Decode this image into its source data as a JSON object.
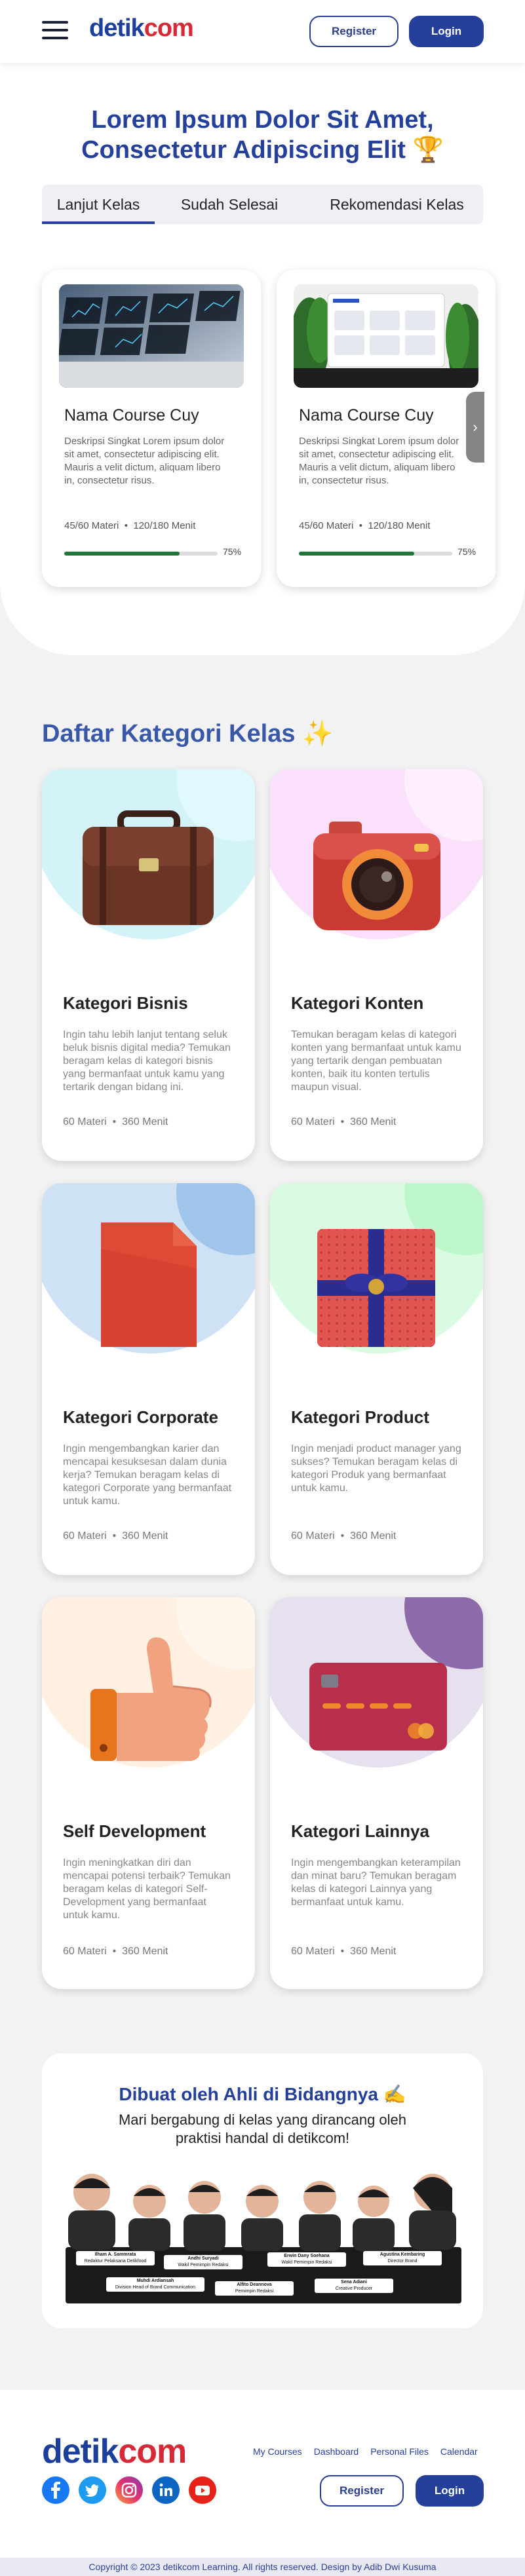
{
  "header": {
    "logo": {
      "part1": "detik",
      "part2": "com"
    },
    "register_label": "Register",
    "login_label": "Login"
  },
  "hero": {
    "line1": "Lorem Ipsum Dolor Sit Amet,",
    "line2": "Consectetur Adipiscing Elit",
    "emoji": "🏆"
  },
  "tabs": [
    {
      "label": "Lanjut Kelas",
      "active": true
    },
    {
      "label": "Sudah Selesai",
      "active": false
    },
    {
      "label": "Rekomendasi Kelas",
      "active": false
    }
  ],
  "courses": [
    {
      "title": "Nama Course Cuy",
      "desc": "Deskripsi Singkat Lorem ipsum dolor sit amet, consectetur adipiscing elit. Mauris a velit dictum, aliquam libero in, consectetur risus.",
      "materi": "45/60 Materi",
      "menit": "120/180 Menit",
      "progress": "75%",
      "progress_value": 0.75
    },
    {
      "title": "Nama Course Cuy",
      "desc": "Deskripsi Singkat Lorem ipsum dolor sit amet, consectetur adipiscing elit. Mauris a velit dictum, aliquam libero in, consectetur risus.",
      "materi": "45/60 Materi",
      "menit": "120/180 Menit",
      "progress": "75%",
      "progress_value": 0.75
    }
  ],
  "next_icon": "chevron-right-icon",
  "categories_title": "Daftar Kategori Kelas",
  "categories_emoji": "✨",
  "categories": [
    {
      "title": "Kategori Bisnis",
      "desc": "Ingin tahu lebih lanjut tentang seluk beluk bisnis digital media? Temukan beragam kelas di kategori bisnis yang bermanfaat untuk kamu yang tertarik dengan bidang ini.",
      "materi": "60 Materi",
      "menit": "360 Menit",
      "bg": "#d3f3f9",
      "accent": "#e4faff",
      "icon": "briefcase-icon"
    },
    {
      "title": "Kategori Konten",
      "desc": "Temukan beragam kelas di kategori konten yang bermanfaat untuk kamu yang tertarik dengan pembuatan konten, baik itu konten tertulis maupun visual.",
      "materi": "60 Materi",
      "menit": "360 Menit",
      "bg": "#fbe0fb",
      "accent": "#fff0ff",
      "icon": "camera-icon"
    },
    {
      "title": "Kategori Corporate",
      "desc": "Ingin mengembangkan karier dan mencapai kesuksesan dalam dunia kerja? Temukan beragam kelas di kategori Corporate yang bermanfaat untuk kamu.",
      "materi": "60 Materi",
      "menit": "360 Menit",
      "bg": "#cfe1f5",
      "accent": "#9fc6ea",
      "icon": "document-icon"
    },
    {
      "title": "Kategori Product",
      "desc": "Ingin menjadi product manager yang sukses? Temukan beragam kelas di kategori Produk yang bermanfaat untuk kamu.",
      "materi": "60 Materi",
      "menit": "360 Menit",
      "bg": "#d9fbe2",
      "accent": "#bff7cd",
      "icon": "gift-icon"
    },
    {
      "title": "Self Development",
      "desc": "Ingin meningkatkan diri dan mencapai potensi terbaik? Temukan beragam kelas di kategori Self-Development yang bermanfaat untuk kamu.",
      "materi": "60 Materi",
      "menit": "360 Menit",
      "bg": "#fff0e1",
      "accent": "#fff5ea",
      "icon": "thumbs-up-icon"
    },
    {
      "title": "Kategori Lainnya",
      "desc": "Ingin mengembangkan keterampilan dan minat baru? Temukan beragam kelas di kategori Lainnya yang bermanfaat untuk kamu.",
      "materi": "60 Materi",
      "menit": "360 Menit",
      "bg": "#e6e0ef",
      "accent": "#8d6aaa",
      "icon": "credit-card-icon"
    }
  ],
  "experts": {
    "title": "Dibuat oleh Ahli di Bidangnya",
    "emoji": "✍️",
    "subtitle_line1": "Mari bergabung di kelas yang dirancang oleh",
    "subtitle_line2": "praktisi handal di detikcom!",
    "names": [
      {
        "name": "Ilham A. Sammrata",
        "role": "Redaktur Pelaksana Detikfood"
      },
      {
        "name": "Andhi Suryadi",
        "role": "Wakil Pemimpin Redaksi"
      },
      {
        "name": "Erwin Dany Soehana",
        "role": "Wakil Pemimpin Redaksi"
      },
      {
        "name": "Agustina Kembaring",
        "role": "Director Brand"
      },
      {
        "name": "Muhdi Ardiansah",
        "role": "Division Head of Brand Communication"
      },
      {
        "name": "Alfito Deannova",
        "role": "Pemimpin Redaksi"
      },
      {
        "name": "Sena Adiani",
        "role": "Creative Producer"
      }
    ]
  },
  "footer": {
    "logo": {
      "part1": "detik",
      "part2": "com"
    },
    "links": [
      "My Courses",
      "Dashboard",
      "Personal Files",
      "Calendar"
    ],
    "social": [
      "facebook-icon",
      "twitter-icon",
      "instagram-icon",
      "linkedin-icon",
      "youtube-icon"
    ],
    "register_label": "Register",
    "login_label": "Login",
    "copyright": "Copyright © 2023 detikcom Learning. All rights reserved. Design by Adib Dwi Kusuma"
  },
  "colors": {
    "brand_blue": "#25409a",
    "brand_red": "#d52a35",
    "progress_green": "#21773a"
  }
}
